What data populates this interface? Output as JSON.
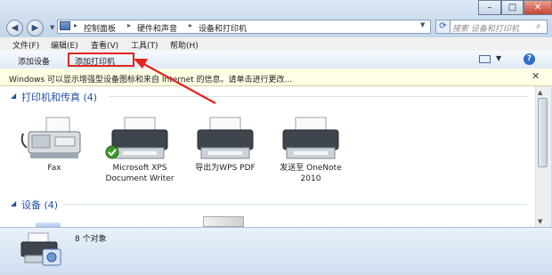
{
  "titlebar": {
    "back_glyph": "◀",
    "forward_glyph": "▶",
    "breadcrumbs": [
      "控制面板",
      "硬件和声音",
      "设备和打印机"
    ],
    "separator": "▸",
    "search_placeholder": "搜索 设备和打印机",
    "window_buttons": {
      "minimize": "–",
      "maximize": "□",
      "close": "✕"
    }
  },
  "menubar": {
    "items": [
      "文件(F)",
      "编辑(E)",
      "查看(V)",
      "工具(T)",
      "帮助(H)"
    ]
  },
  "commandbar": {
    "add_device": "添加设备",
    "add_printer": "添加打印机",
    "help_glyph": "?"
  },
  "infobar": {
    "text": "Windows 可以显示增强型设备图标和来自 Internet 的信息。请单击进行更改...",
    "close_glyph": "✕"
  },
  "groups": {
    "printers": {
      "title": "打印机和传真 (4)",
      "devices": [
        {
          "label": "Fax",
          "icon": "fax-icon"
        },
        {
          "label": "Microsoft XPS Document Writer",
          "icon": "printer-icon",
          "is_default": true
        },
        {
          "label": "导出为WPS PDF",
          "icon": "printer-icon"
        },
        {
          "label": "发送至 OneNote 2010",
          "icon": "printer-icon"
        }
      ]
    },
    "devices": {
      "title": "设备 (4)"
    }
  },
  "details": {
    "count": "8 个对象"
  },
  "colors": {
    "annotation_red": "#e3261c",
    "group_title_blue": "#2450a6",
    "info_bg": "#fffee5"
  }
}
